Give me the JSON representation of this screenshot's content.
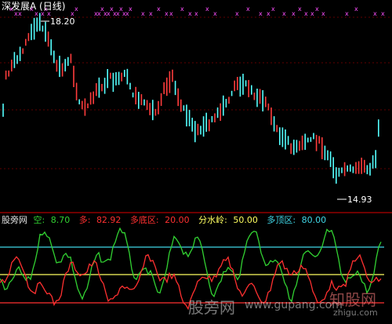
{
  "title": "深发展A (日线)",
  "main": {
    "high_label": "18.20",
    "low_label": "14.93"
  },
  "indicator": {
    "name": "股旁网",
    "items": [
      {
        "label": "空:",
        "value": "8.70",
        "color": "#32d232"
      },
      {
        "label": "多:",
        "value": "82.92",
        "color": "#ff3030"
      },
      {
        "label": "多底区:",
        "value": "20.00",
        "color": "#ff3030"
      },
      {
        "label": "分水岭:",
        "value": "50.00",
        "color": "#ffff60"
      },
      {
        "label": "多顶区:",
        "value": "80.00",
        "color": "#40d8e8"
      }
    ]
  },
  "watermark": {
    "text1": "股旁网",
    "text2": "www.gupang.com",
    "text3": "知股网",
    "text4": "zhigu.com"
  },
  "colors": {
    "up": "#ff3c3c",
    "down": "#54ffff",
    "marker": "#ff50ff",
    "grid": "#8b0000"
  }
}
